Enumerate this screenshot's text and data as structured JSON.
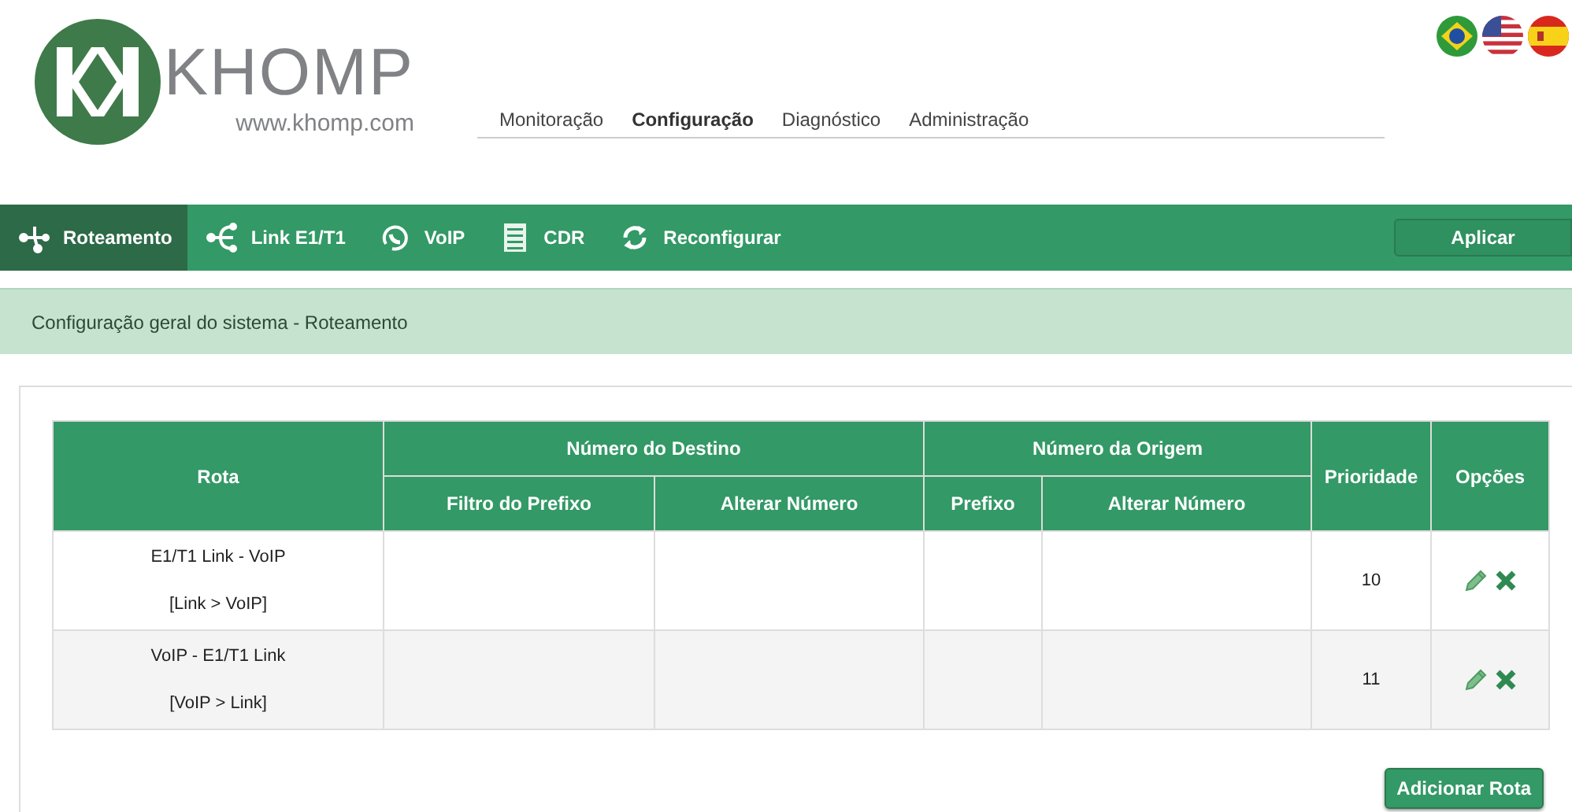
{
  "logo": {
    "name": "KHOMP",
    "url": "www.khomp.com"
  },
  "languages": [
    {
      "kind": "br"
    },
    {
      "kind": "us"
    },
    {
      "kind": "es"
    }
  ],
  "nav": [
    {
      "label": "Monitoração",
      "selected": false
    },
    {
      "label": "Configuração",
      "selected": true
    },
    {
      "label": "Diagnóstico",
      "selected": false
    },
    {
      "label": "Administração",
      "selected": false
    }
  ],
  "toolbar": {
    "tabs": [
      {
        "label": "Roteamento",
        "kind": "routing",
        "selected": true
      },
      {
        "label": "Link E1/T1",
        "kind": "link",
        "selected": false
      },
      {
        "label": "VoIP",
        "kind": "voip",
        "selected": false
      },
      {
        "label": "CDR",
        "kind": "cdr",
        "selected": false
      },
      {
        "label": "Reconfigurar",
        "kind": "reload",
        "selected": false
      }
    ],
    "apply_button": "Aplicar"
  },
  "section_title": "Configuração geral do sistema - Roteamento",
  "table": {
    "route_header": "Rota",
    "groups": [
      {
        "label": "Número do Destino",
        "columns": [
          "Filtro do Prefixo",
          "Alterar Número"
        ]
      },
      {
        "label": "Número da Origem",
        "columns": [
          "Prefixo",
          "Alterar Número"
        ]
      }
    ],
    "priority_header": "Prioridade",
    "options_header": "Opções",
    "rows": [
      {
        "route": "E1/T1 Link - VoIP",
        "direction": "[Link > VoIP]",
        "priority": "10"
      },
      {
        "route": "VoIP - E1/T1 Link",
        "direction": "[VoIP > Link]",
        "priority": "11"
      }
    ]
  },
  "add_button": "Adicionar Rota"
}
